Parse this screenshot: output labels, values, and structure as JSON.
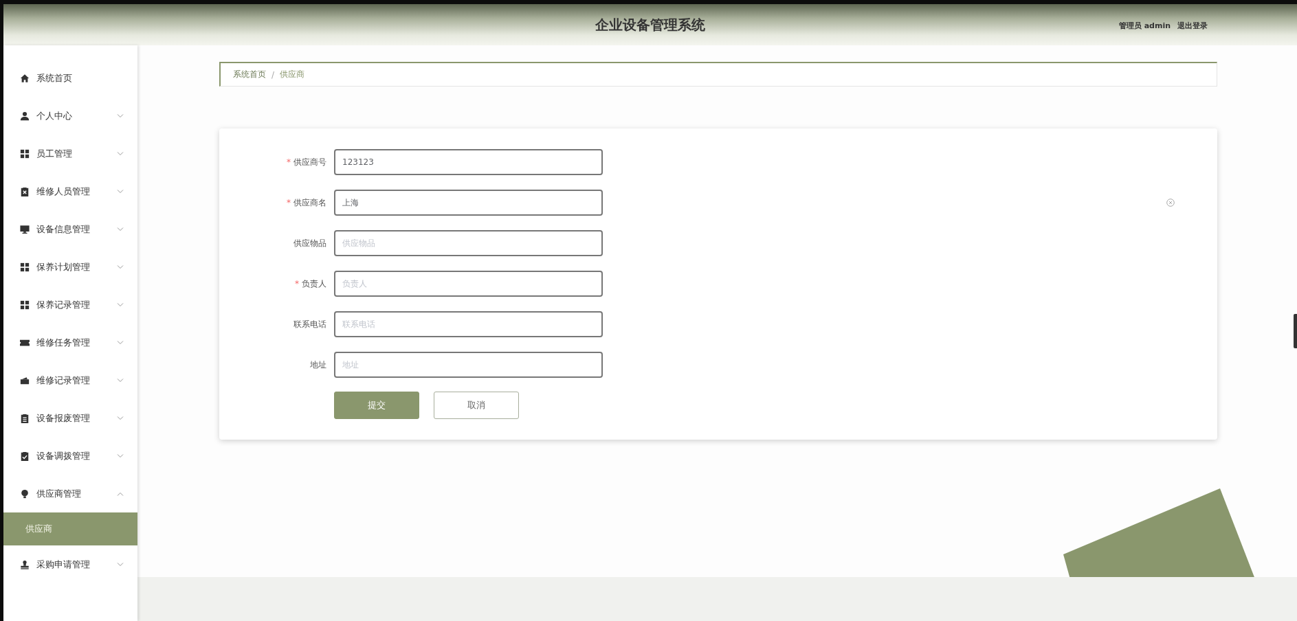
{
  "header": {
    "title": "企业设备管理系统",
    "user_label": "管理员 admin",
    "logout": "退出登录"
  },
  "sidebar": {
    "items": [
      {
        "kind": "home",
        "label": "系统首页"
      },
      {
        "kind": "user",
        "label": "个人中心",
        "expanded": false
      },
      {
        "kind": "grid",
        "label": "员工管理",
        "expanded": false
      },
      {
        "kind": "clipboard-x",
        "label": "维修人员管理",
        "expanded": false
      },
      {
        "kind": "monitor",
        "label": "设备信息管理",
        "expanded": false
      },
      {
        "kind": "grid",
        "label": "保养计划管理",
        "expanded": false
      },
      {
        "kind": "grid",
        "label": "保养记录管理",
        "expanded": false
      },
      {
        "kind": "ticket",
        "label": "维修任务管理",
        "expanded": false
      },
      {
        "kind": "wallet",
        "label": "维修记录管理",
        "expanded": false
      },
      {
        "kind": "clipboard",
        "label": "设备报废管理",
        "expanded": false
      },
      {
        "kind": "clipboard-check",
        "label": "设备调拨管理",
        "expanded": false
      },
      {
        "kind": "bulb",
        "label": "供应商管理",
        "expanded": true,
        "children": [
          {
            "label": "供应商",
            "selected": true
          }
        ]
      },
      {
        "kind": "stamp",
        "label": "采购申请管理",
        "expanded": false
      }
    ]
  },
  "breadcrumb": {
    "items": [
      "系统首页",
      "供应商"
    ],
    "separator": "/"
  },
  "form": {
    "fields": [
      {
        "label": "供应商号",
        "required_mark": "*",
        "value": "123123"
      },
      {
        "label": "供应商名",
        "required_mark": "*",
        "value": "上海",
        "clear_icon": true
      },
      {
        "label": "供应物品",
        "placeholder": "供应物品"
      },
      {
        "label": "负责人",
        "required_mark": "*",
        "placeholder": "负责人"
      },
      {
        "label": "联系电话",
        "placeholder": "联系电话"
      },
      {
        "label": "地址",
        "placeholder": "地址"
      }
    ],
    "buttons": [
      {
        "label": "提交",
        "kind": "primary"
      },
      {
        "label": "取消",
        "kind": "plain"
      }
    ]
  }
}
